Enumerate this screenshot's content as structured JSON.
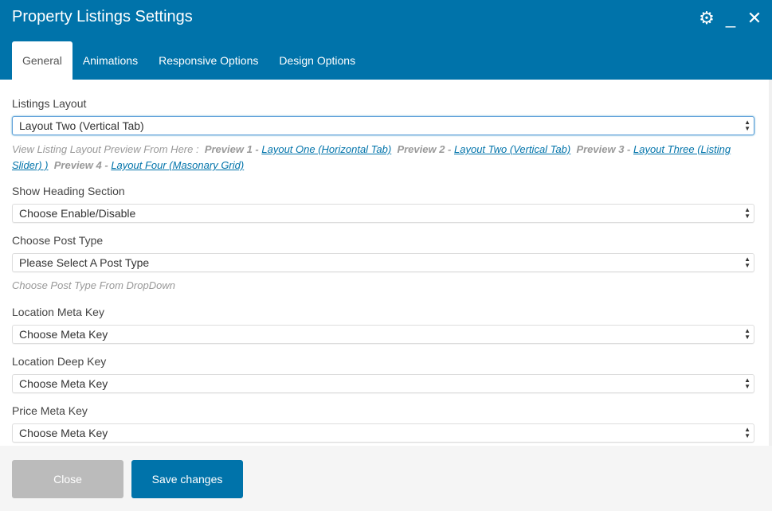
{
  "window": {
    "title": "Property Listings Settings",
    "icons": [
      "gear-icon",
      "minimize-icon",
      "close-icon"
    ]
  },
  "tabs": [
    {
      "label": "General",
      "active": true
    },
    {
      "label": "Animations"
    },
    {
      "label": "Responsive Options"
    },
    {
      "label": "Design Options"
    }
  ],
  "fields": [
    {
      "label": "Listings Layout",
      "value": "Layout Two (Vertical Tab)"
    },
    {
      "label": "Show Heading Section",
      "value": "Choose Enable/Disable"
    },
    {
      "label": "Choose Post Type",
      "value": "Please Select A Post Type",
      "hint": "Choose Post Type From DropDown"
    },
    {
      "label": "Location Meta Key",
      "value": "Choose Meta Key"
    },
    {
      "label": "Location Deep Key",
      "value": "Choose Meta Key"
    },
    {
      "label": "Price Meta Key",
      "value": "Choose Meta Key"
    }
  ],
  "preview": {
    "intro": "View Listing Layout Preview From Here :",
    "items": [
      {
        "prefix": "Preview 1 -",
        "link": "Layout One (Horizontal Tab)"
      },
      {
        "prefix": "Preview 2 -",
        "link": "Layout Two (Vertical Tab)"
      },
      {
        "prefix": "Preview 3 -",
        "link": "Layout Three (Listing Slider) )"
      },
      {
        "prefix": "Preview 4 -",
        "link": "Layout Four (Masonary Grid)"
      }
    ]
  },
  "footer": {
    "close_label": "Close",
    "save_label": "Save changes"
  },
  "colors": {
    "brand": "#0073aa",
    "close_button": "#bbbbbb",
    "footer_bg": "#f5f5f5"
  }
}
